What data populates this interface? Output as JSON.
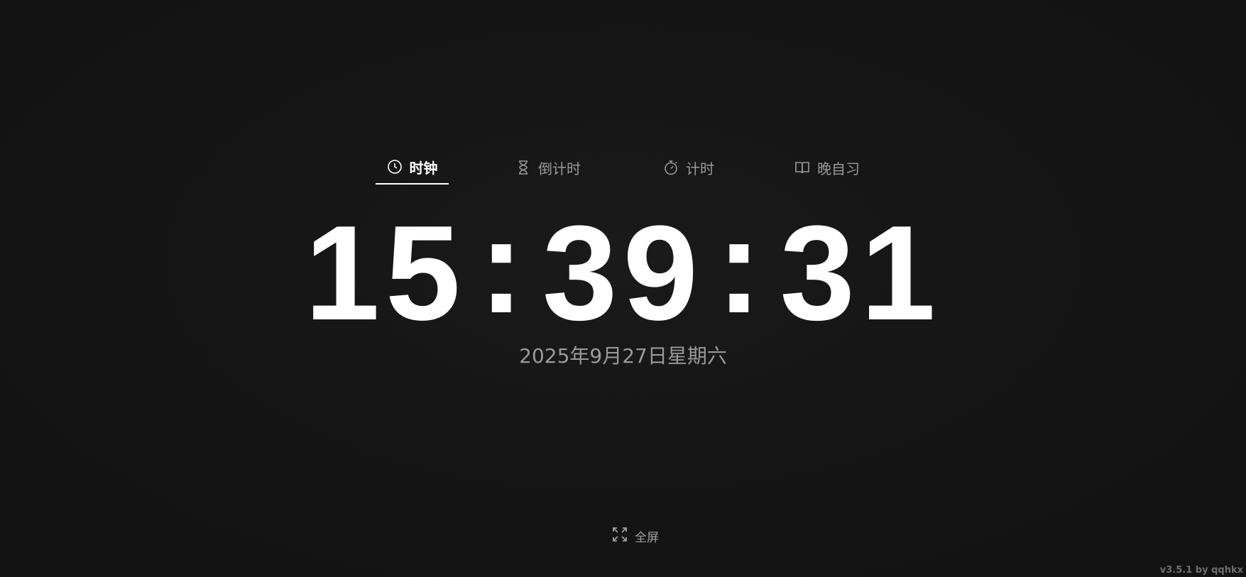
{
  "tabs": [
    {
      "label": "时钟",
      "icon": "clock-icon",
      "active": true
    },
    {
      "label": "倒计时",
      "icon": "hourglass-icon",
      "active": false
    },
    {
      "label": "计时",
      "icon": "stopwatch-icon",
      "active": false
    },
    {
      "label": "晚自习",
      "icon": "book-icon",
      "active": false
    }
  ],
  "clock": {
    "hours": "15",
    "minutes": "39",
    "seconds": "31",
    "separator": ":"
  },
  "date": "2025年9月27日星期六",
  "fullscreen": {
    "label": "全屏",
    "icon": "expand-icon"
  },
  "footer": {
    "version": "v3.5.1  by qqhkx"
  },
  "colors": {
    "background": "#151515",
    "primary_text": "#ffffff",
    "muted_text": "#9a9a9a"
  }
}
